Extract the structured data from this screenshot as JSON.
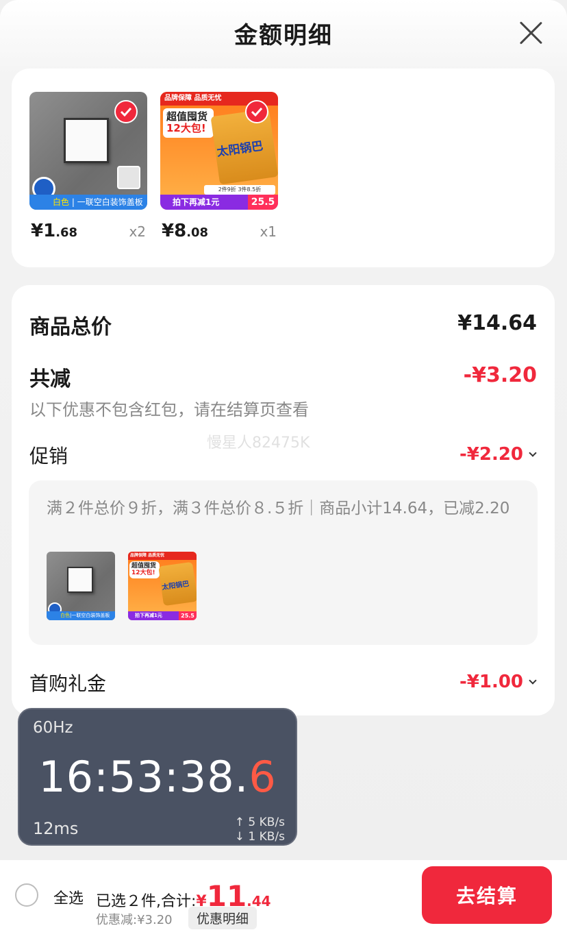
{
  "header": {
    "title": "金额明细"
  },
  "products": [
    {
      "thumb": {
        "tag_color": "白色",
        "tag_text": "一联空白装饰盖板"
      },
      "price_main": "¥1",
      "price_decimal": ".68",
      "qty": "x2",
      "selected": true
    },
    {
      "thumb": {
        "topbar": "品牌保障 品质无忧",
        "box_line1": "超值囤货",
        "box_line2": "12大包!",
        "pkg_text": "太阳锅巴",
        "promo": "2件9折 3件8.5折",
        "footer": "拍下再减1元",
        "footer_price": "25.5"
      },
      "price_main": "¥8",
      "price_decimal": ".08",
      "qty": "x1",
      "selected": true
    }
  ],
  "summary": {
    "total_label": "商品总价",
    "total_value": "¥14.64",
    "reduce_label": "共减",
    "reduce_value": "-¥3.20",
    "note": "以下优惠不包含红包，请在结算页查看",
    "watermark": "慢星人82475K",
    "promo_label": "促销",
    "promo_value": "-¥2.20",
    "promo_detail": "满２件总价９折，满３件总价８.５折｜商品小计14.64，已减2.20",
    "gift_label": "首购礼金",
    "gift_value": "-¥1.00"
  },
  "overlay": {
    "refresh_rate": "60Hz",
    "time_main": "16:53:38.",
    "time_fraction": "6",
    "latency": "12ms",
    "upload": "↑ 5 KB/s",
    "download": "↓ 1 KB/s"
  },
  "bottom_bar": {
    "select_all": "全选",
    "selected_text": "已选２件,合计:",
    "currency": "¥",
    "amount_main": "11",
    "amount_decimal": ".44",
    "discount_text": "优惠减:¥3.20",
    "discount_detail": "优惠明细",
    "checkout": "去结算"
  },
  "colors": {
    "accent_red": "#f0283c",
    "overlay_bg": "#4a5263"
  }
}
